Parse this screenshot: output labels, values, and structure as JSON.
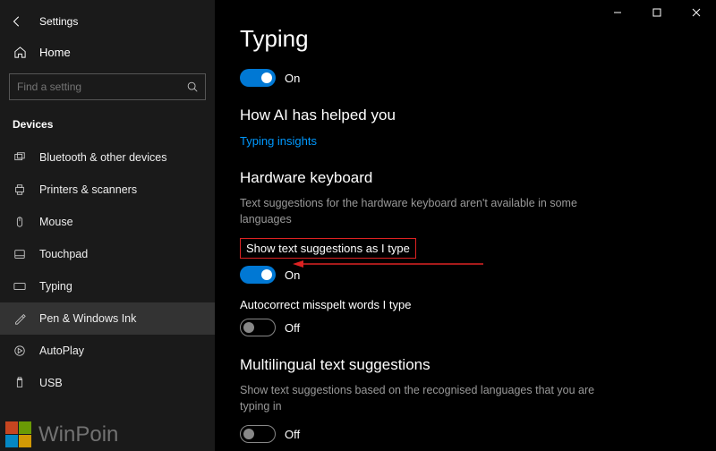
{
  "titlebar": {
    "app": "Settings"
  },
  "home": "Home",
  "search": {
    "placeholder": "Find a setting"
  },
  "section": "Devices",
  "nav": [
    {
      "label": "Bluetooth & other devices"
    },
    {
      "label": "Printers & scanners"
    },
    {
      "label": "Mouse"
    },
    {
      "label": "Touchpad"
    },
    {
      "label": "Typing"
    },
    {
      "label": "Pen & Windows Ink"
    },
    {
      "label": "AutoPlay"
    },
    {
      "label": "USB"
    }
  ],
  "page": {
    "title": "Typing",
    "toggle0_on": "On",
    "aiHead": "How AI has helped you",
    "aiLink": "Typing insights",
    "hwHead": "Hardware keyboard",
    "hwDesc": "Text suggestions for the hardware keyboard aren't available in some languages",
    "opt1": "Show text suggestions as I type",
    "opt1_state": "On",
    "opt2": "Autocorrect misspelt words I type",
    "opt2_state": "Off",
    "multiHead": "Multilingual text suggestions",
    "multiDesc": "Show text suggestions based on the recognised languages that you are typing in",
    "multi_state": "Off"
  },
  "watermark": "WinPoin"
}
